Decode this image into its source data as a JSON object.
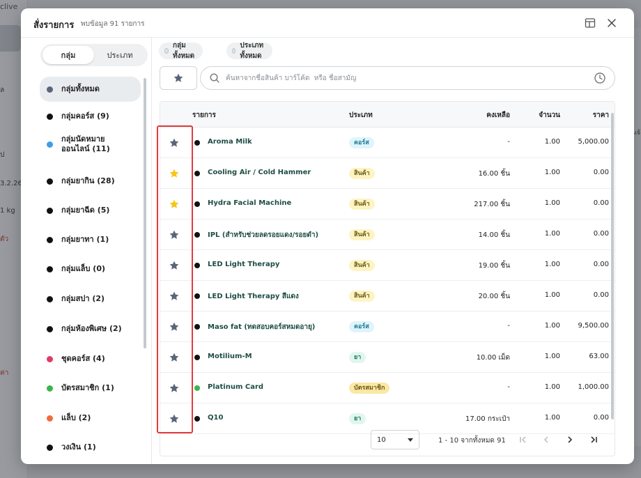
{
  "background": {
    "brand_fragment": "clive",
    "fragments": [
      "ล",
      "ป",
      "3.2.26",
      "1 kg",
      "ตัว",
      "ค่า"
    ],
    "right_fragment": "แจ้"
  },
  "modal": {
    "title": "สั่งรายการ",
    "subtitle": "พบข้อมูล 91 รายการ"
  },
  "segment": {
    "tabs": [
      {
        "label": "กลุ่ม",
        "active": true
      },
      {
        "label": "ประเภท",
        "active": false
      }
    ]
  },
  "groups": [
    {
      "label": "กลุ่มทั้งหมด",
      "color": "#5a6678",
      "active": true
    },
    {
      "label": "กลุ่มคอร์ส (9)",
      "color": "#111111"
    },
    {
      "label": "กลุ่มนัดหมาย\nออนไลน์ (11)",
      "color": "#3d9ee8"
    },
    {
      "label": "กลุ่มยากิน (28)",
      "color": "#111111"
    },
    {
      "label": "กลุ่มยาฉีด (5)",
      "color": "#111111"
    },
    {
      "label": "กลุ่มยาทา (1)",
      "color": "#111111"
    },
    {
      "label": "กลุ่มแล็บ (0)",
      "color": "#111111"
    },
    {
      "label": "กลุ่มสปา (2)",
      "color": "#111111"
    },
    {
      "label": "กลุ่มห้องพิเศษ (2)",
      "color": "#111111"
    },
    {
      "label": "ชุดคอร์ส (4)",
      "color": "#e23a66"
    },
    {
      "label": "บัตรสมาชิก (1)",
      "color": "#3bb54a"
    },
    {
      "label": "แล็บ (2)",
      "color": "#f26b3a"
    },
    {
      "label": "วงเงิน (1)",
      "color": "#111111"
    }
  ],
  "filters": {
    "chips": [
      "กลุ่มทั้งหมด",
      "ประเภททั้งหมด"
    ],
    "search_placeholder": "ค้นหาจากชื่อสินค้า บาร์โค้ด  หรือ ชื่อสามัญ"
  },
  "table": {
    "headers": {
      "name": "รายการ",
      "type": "ประเภท",
      "stock": "คงเหลือ",
      "qty": "จำนวน",
      "price": "ราคา"
    },
    "rows": [
      {
        "fav": false,
        "dot": "#111111",
        "name": "Aroma Milk",
        "type": "คอร์ส",
        "type_bg": "#dff4fb",
        "type_fg": "#1e7a95",
        "stock": "-",
        "qty": "1.00",
        "price": "5,000.00"
      },
      {
        "fav": true,
        "dot": "#111111",
        "name": "Cooling Air / Cold Hammer",
        "type": "สินค้า",
        "type_bg": "#fdf4c4",
        "type_fg": "#6b5a10",
        "stock": "16.00 ชิ้น",
        "qty": "1.00",
        "price": "0.00"
      },
      {
        "fav": true,
        "dot": "#111111",
        "name": "Hydra Facial Machine",
        "type": "สินค้า",
        "type_bg": "#fdf4c4",
        "type_fg": "#6b5a10",
        "stock": "217.00 ชิ้น",
        "qty": "1.00",
        "price": "0.00"
      },
      {
        "fav": false,
        "dot": "#111111",
        "name": "IPL (สำหรับช่วยลดรอยแดง/รอยดำ)",
        "type": "สินค้า",
        "type_bg": "#fdf4c4",
        "type_fg": "#6b5a10",
        "stock": "14.00 ชิ้น",
        "qty": "1.00",
        "price": "0.00"
      },
      {
        "fav": false,
        "dot": "#111111",
        "name": "LED Light Therapy",
        "type": "สินค้า",
        "type_bg": "#fdf4c4",
        "type_fg": "#6b5a10",
        "stock": "19.00 ชิ้น",
        "qty": "1.00",
        "price": "0.00"
      },
      {
        "fav": false,
        "dot": "#111111",
        "name": "LED Light Therapy สีแดง",
        "type": "สินค้า",
        "type_bg": "#fdf4c4",
        "type_fg": "#6b5a10",
        "stock": "20.00 ชิ้น",
        "qty": "1.00",
        "price": "0.00"
      },
      {
        "fav": false,
        "dot": "#111111",
        "name": "Maso fat (ทดสอบคอร์สหมดอายุ)",
        "type": "คอร์ส",
        "type_bg": "#dff4fb",
        "type_fg": "#1e7a95",
        "stock": "-",
        "qty": "1.00",
        "price": "9,500.00"
      },
      {
        "fav": false,
        "dot": "#111111",
        "name": "Motilium-M",
        "type": "ยา",
        "type_bg": "#e1f6ee",
        "type_fg": "#1f7a5a",
        "stock": "10.00 เม็ด",
        "qty": "1.00",
        "price": "63.00"
      },
      {
        "fav": false,
        "dot": "#3bb54a",
        "name": "Platinum Card",
        "type": "บัตรสมาชิก",
        "type_bg": "#fbe7a6",
        "type_fg": "#6b5a10",
        "stock": "-",
        "qty": "1.00",
        "price": "1,000.00"
      },
      {
        "fav": false,
        "dot": "#111111",
        "name": "Q10",
        "type": "ยา",
        "type_bg": "#e1f6ee",
        "type_fg": "#1f7a5a",
        "stock": "17.00 กระเป๋า",
        "qty": "1.00",
        "price": "0.00"
      }
    ]
  },
  "pagination": {
    "page_size": "10",
    "info": "1 - 10 จากทั้งหมด 91"
  },
  "colors": {
    "star_default": "#5a6678",
    "star_favorite": "#f5c518",
    "highlight_box": "#e23a3a"
  }
}
